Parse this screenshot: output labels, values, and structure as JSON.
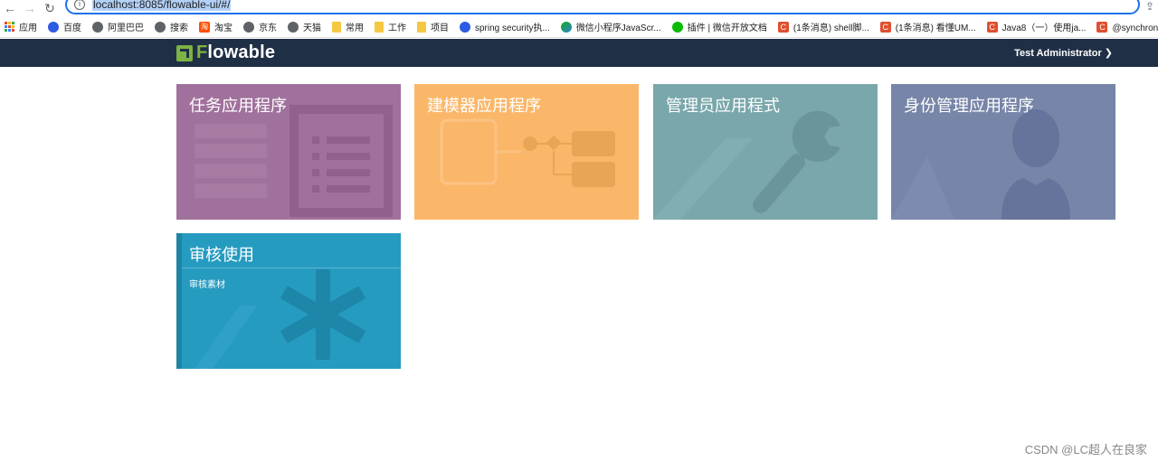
{
  "browser": {
    "url": "localhost:8085/flowable-ui/#/",
    "bookmarks": [
      {
        "label": "应用",
        "icon": "apps-grid-icon"
      },
      {
        "label": "百度",
        "icon": "baidu-paw-icon"
      },
      {
        "label": "阿里巴巴",
        "icon": "globe-icon"
      },
      {
        "label": "搜索",
        "icon": "globe-icon"
      },
      {
        "label": "淘宝",
        "icon": "taobao-icon"
      },
      {
        "label": "京东",
        "icon": "globe-icon"
      },
      {
        "label": "天猫",
        "icon": "globe-icon"
      },
      {
        "label": "常用",
        "icon": "folder-icon"
      },
      {
        "label": "工作",
        "icon": "folder-icon"
      },
      {
        "label": "项目",
        "icon": "folder-icon"
      },
      {
        "label": "spring security执...",
        "icon": "baidu-paw-icon"
      },
      {
        "label": "微信小程序JavaScr...",
        "icon": "wechat-miniapp-icon"
      },
      {
        "label": "插件 | 微信开放文档",
        "icon": "wechat-icon"
      },
      {
        "label": "(1条消息) shell脚...",
        "icon": "csdn-icon"
      },
      {
        "label": "(1条消息) 看懂UM...",
        "icon": "csdn-icon"
      },
      {
        "label": "Java8（一）使用ja...",
        "icon": "csdn-icon"
      },
      {
        "label": "@synchronized 递...",
        "icon": "csdn-icon"
      }
    ]
  },
  "header": {
    "logo_prefix": "F",
    "logo_rest": "lowable",
    "user_label": "Test Administrator ❯"
  },
  "tiles": [
    {
      "title": "任务应用程序",
      "color": "#a0719c"
    },
    {
      "title": "建模器应用程序",
      "color": "#fbb769"
    },
    {
      "title": "管理员应用程式",
      "color": "#7aa7ab"
    },
    {
      "title": "身份管理应用程序",
      "color": "#7785a8"
    },
    {
      "title": "审核使用",
      "subtitle": "审核素材",
      "color": "#269bc0"
    }
  ],
  "watermark": "CSDN @LC超人在良家"
}
